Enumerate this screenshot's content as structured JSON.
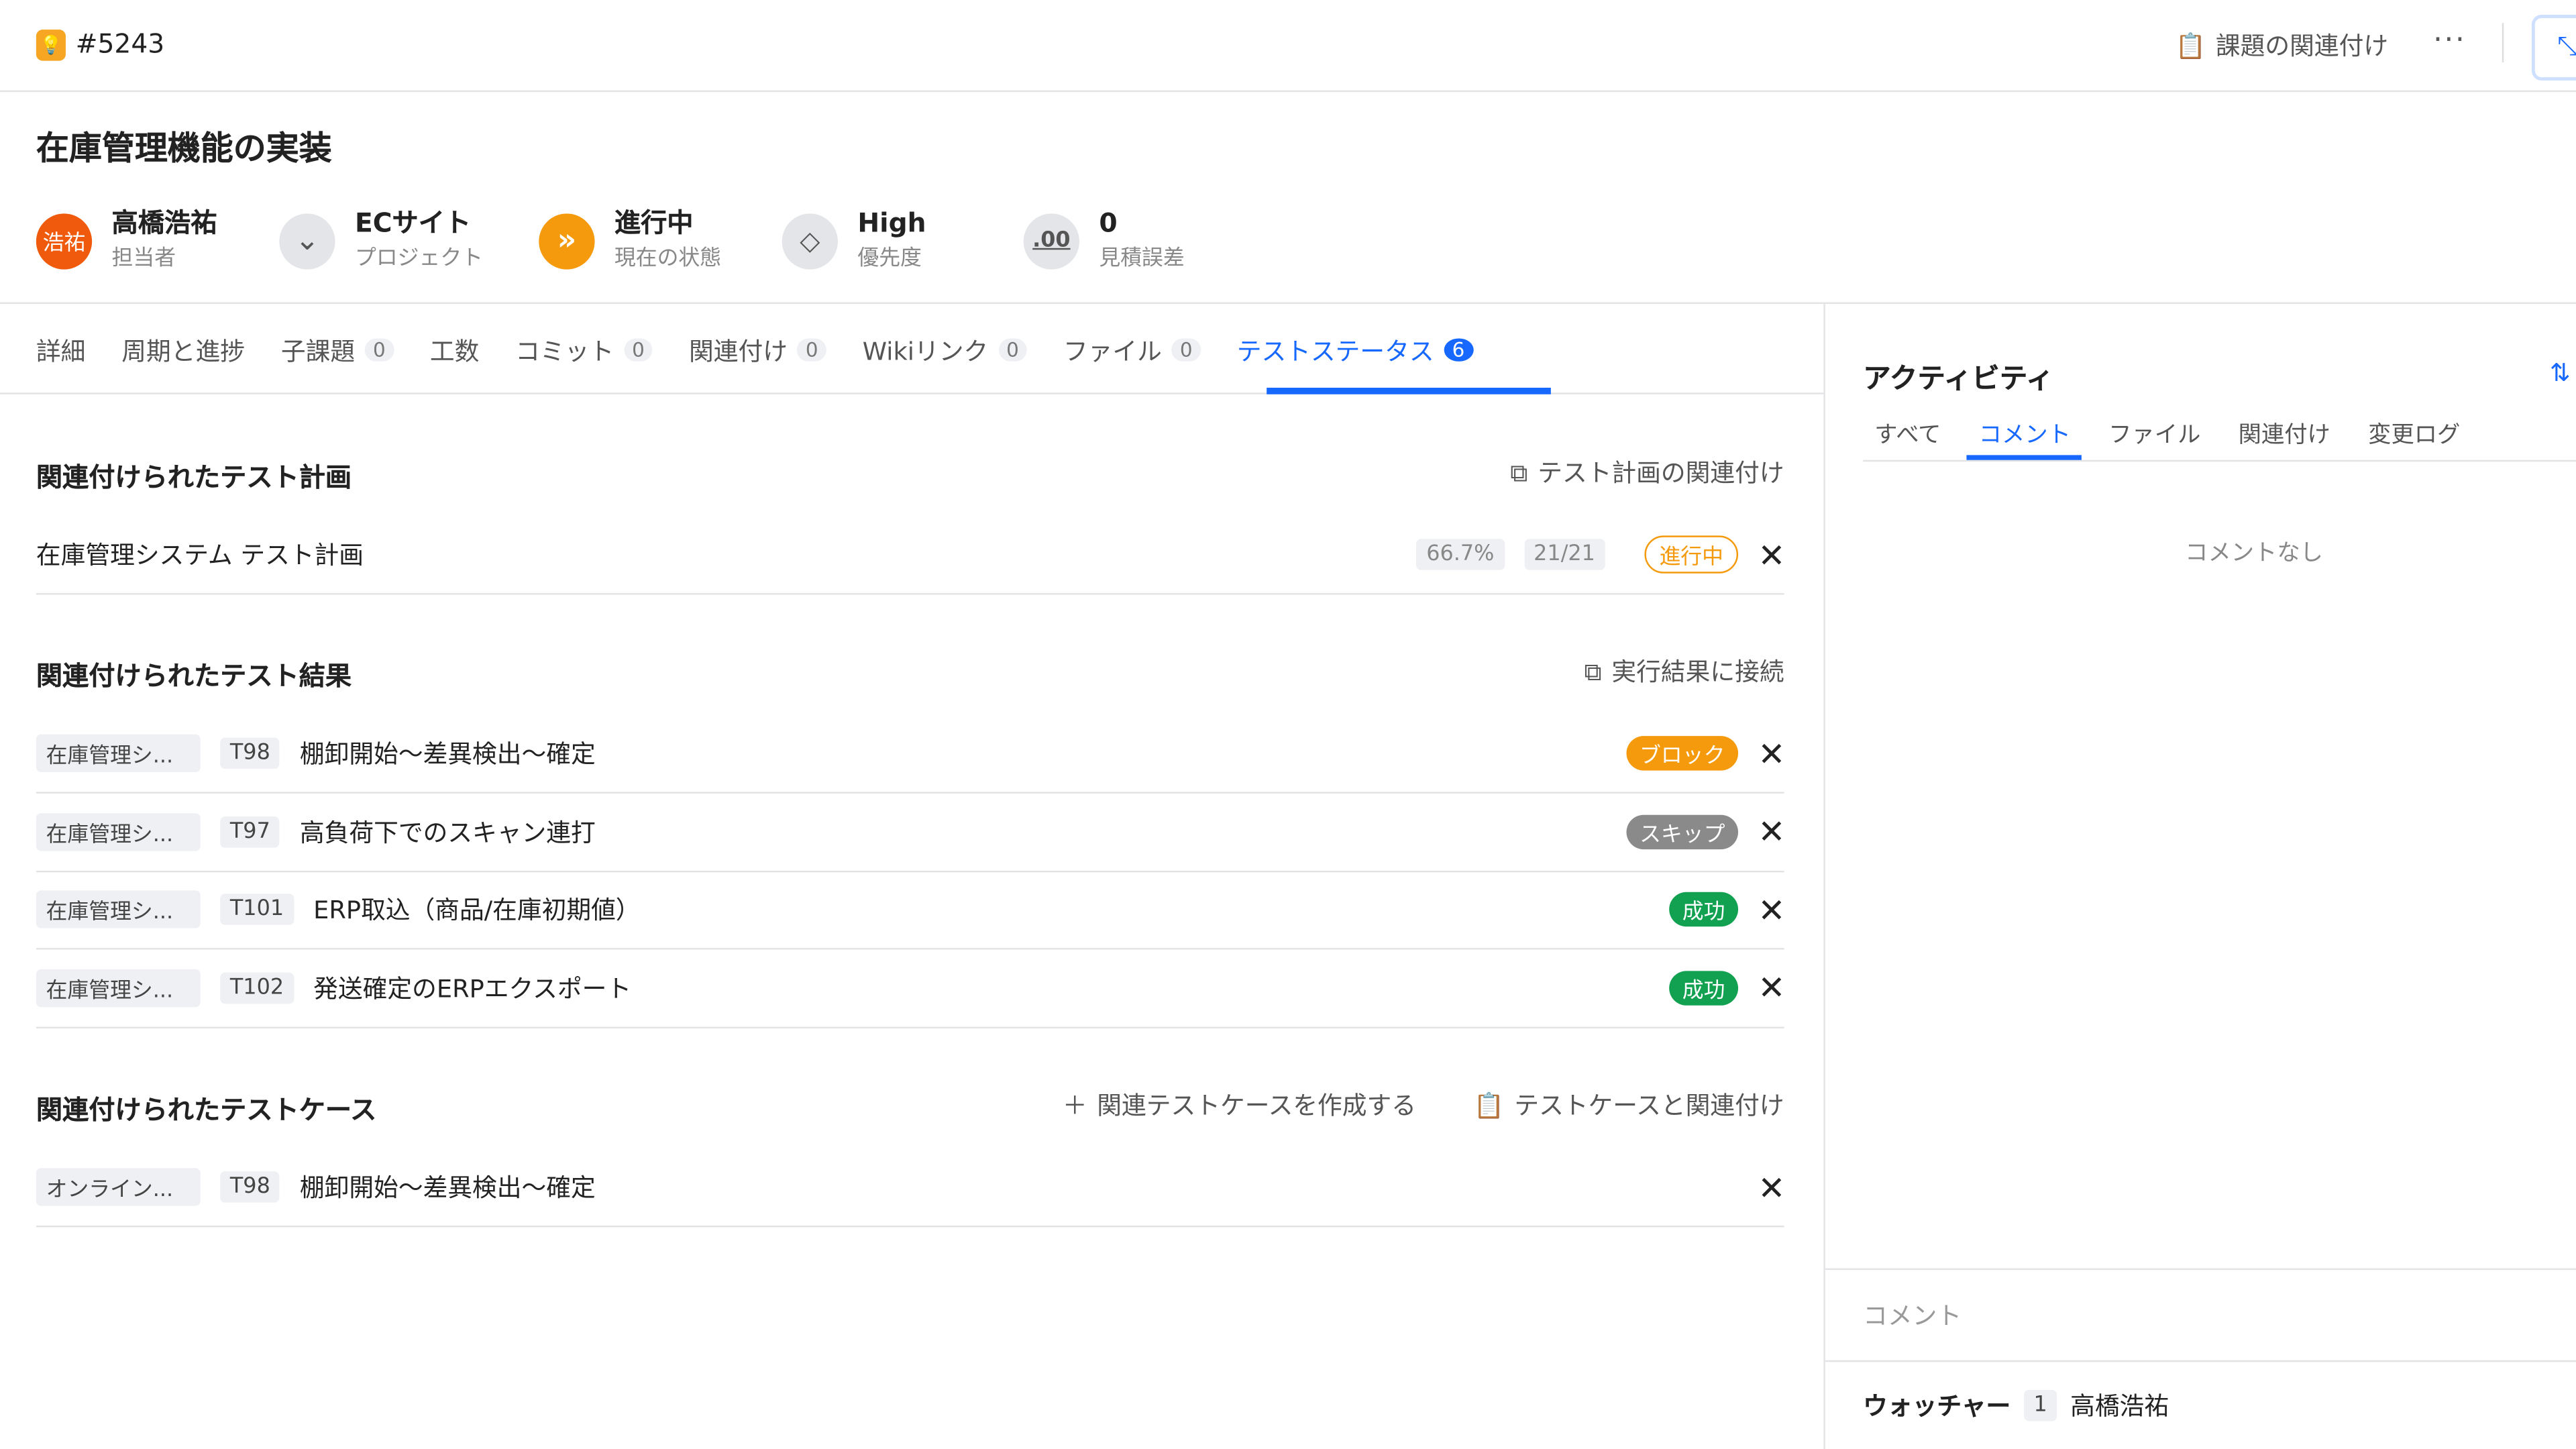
{
  "topbar": {
    "issue_id": "#5243",
    "link_issue": "課題の関連付け",
    "more": "···"
  },
  "issue": {
    "title": "在庫管理機能の実装",
    "meta": [
      {
        "value": "高橋浩祐",
        "label": "担当者",
        "avatar": "浩祐"
      },
      {
        "value": "ECサイト",
        "label": "プロジェクト"
      },
      {
        "value": "進行中",
        "label": "現在の状態"
      },
      {
        "value": "High",
        "label": "優先度"
      },
      {
        "value": "0",
        "label": "見積誤差",
        "icon_text": ".00"
      }
    ]
  },
  "tabs": [
    {
      "label": "詳細"
    },
    {
      "label": "周期と進捗"
    },
    {
      "label": "子課題",
      "count": "0"
    },
    {
      "label": "工数"
    },
    {
      "label": "コミット",
      "count": "0"
    },
    {
      "label": "関連付け",
      "count": "0"
    },
    {
      "label": "Wikiリンク",
      "count": "0"
    },
    {
      "label": "ファイル",
      "count": "0"
    },
    {
      "label": "テストステータス",
      "count": "6"
    }
  ],
  "plans": {
    "title": "関連付けられたテスト計画",
    "action": "テスト計画の関連付け",
    "items": [
      {
        "name": "在庫管理システム テスト計画",
        "progress": "66.7%",
        "count": "21/21",
        "status": "進行中"
      }
    ]
  },
  "results": {
    "title": "関連付けられたテスト結果",
    "action": "実行結果に接続",
    "items": [
      {
        "plan": "在庫管理シ...",
        "id": "T98",
        "name": "棚卸開始～差異検出～確定",
        "status": "ブロック",
        "color": "#f59a0c"
      },
      {
        "plan": "在庫管理シ...",
        "id": "T97",
        "name": "高負荷下でのスキャン連打",
        "status": "スキップ",
        "color": "#8a8a8a"
      },
      {
        "plan": "在庫管理シ...",
        "id": "T101",
        "name": "ERP取込（商品/在庫初期値）",
        "status": "成功",
        "color": "#12a150"
      },
      {
        "plan": "在庫管理シ...",
        "id": "T102",
        "name": "発送確定のERPエクスポート",
        "status": "成功",
        "color": "#12a150"
      }
    ]
  },
  "cases": {
    "title": "関連付けられたテストケース",
    "create": "関連テストケースを作成する",
    "link": "テストケースと関連付け",
    "items": [
      {
        "plan": "オンライン...",
        "id": "T98",
        "name": "棚卸開始～差異検出～確定"
      }
    ]
  },
  "activity": {
    "title": "アクティビティ",
    "tabs": [
      "すべて",
      "コメント",
      "ファイル",
      "関連付け",
      "変更ログ"
    ],
    "active_tab": "コメント",
    "empty": "コメントなし",
    "comment_placeholder": "コメント",
    "watchers_label": "ウォッチャー",
    "watchers_count": "1",
    "watcher": "高橋浩祐"
  }
}
